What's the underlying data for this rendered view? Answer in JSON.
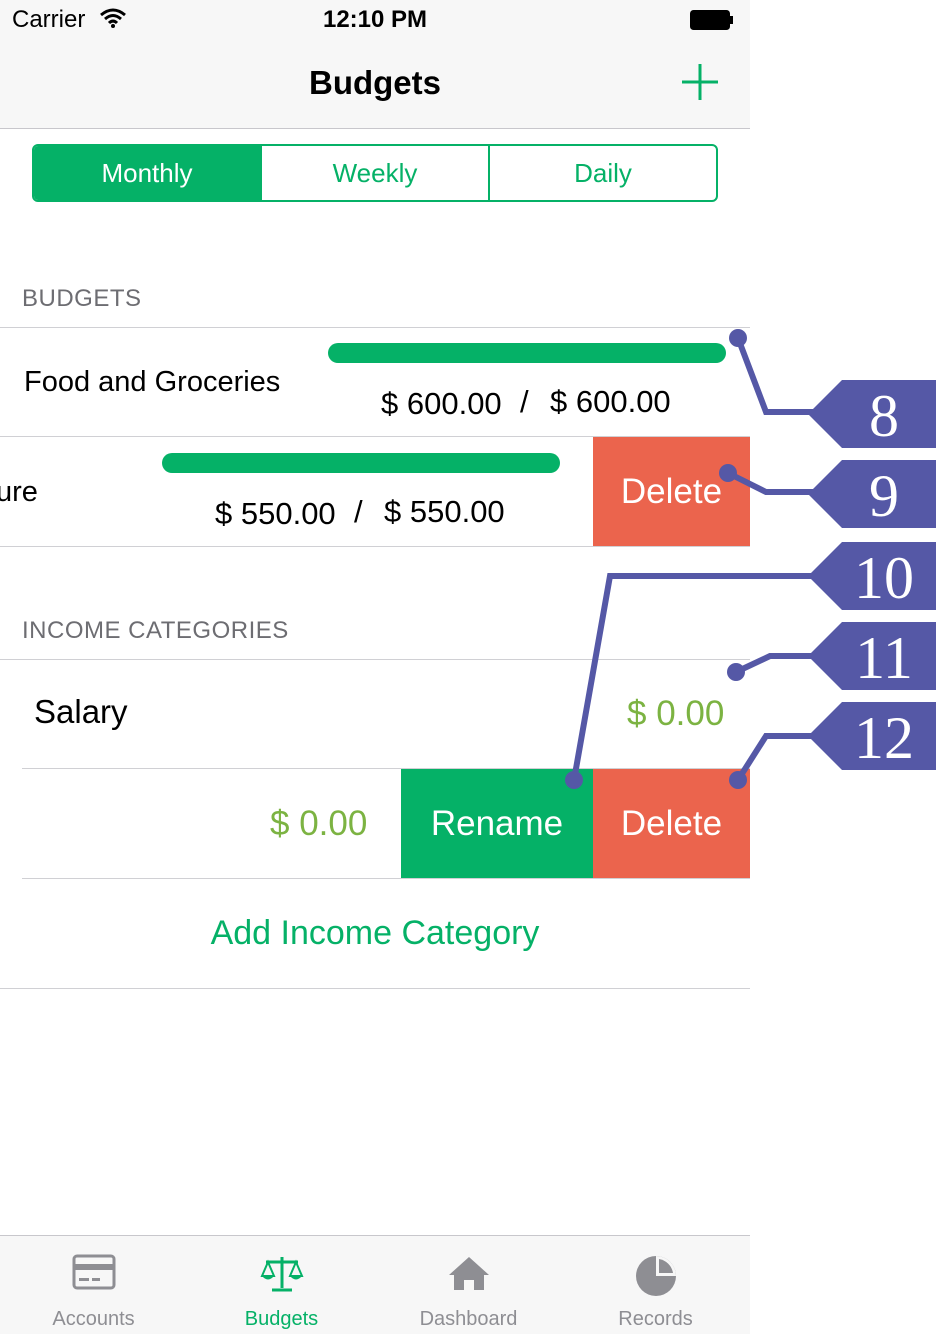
{
  "status_bar": {
    "carrier": "Carrier",
    "time": "12:10 PM"
  },
  "nav": {
    "title": "Budgets",
    "add_icon": "plus-icon"
  },
  "period_tabs": [
    {
      "label": "Monthly",
      "selected": true
    },
    {
      "label": "Weekly",
      "selected": false
    },
    {
      "label": "Daily",
      "selected": false
    }
  ],
  "budgets": {
    "header": "BUDGETS",
    "items": [
      {
        "label": "Food and Groceries",
        "spent": "$ 600.00",
        "separator": "/",
        "limit": "$ 600.00",
        "progress": 1.0
      },
      {
        "label_visible_fragment": "ure",
        "spent": "$ 550.00",
        "separator": "/",
        "limit": "$ 550.00",
        "progress": 1.0,
        "action": "Delete"
      }
    ]
  },
  "income": {
    "header": "INCOME CATEGORIES",
    "items": [
      {
        "label": "Salary",
        "amount": "$ 0.00"
      },
      {
        "amount": "$ 0.00",
        "actions": [
          "Rename",
          "Delete"
        ]
      }
    ],
    "add_label": "Add Income Category"
  },
  "tab_bar": [
    {
      "label": "Accounts",
      "icon": "credit-card-icon",
      "active": false
    },
    {
      "label": "Budgets",
      "icon": "scale-icon",
      "active": true
    },
    {
      "label": "Dashboard",
      "icon": "house-icon",
      "active": false
    },
    {
      "label": "Records",
      "icon": "pie-chart-icon",
      "active": false
    }
  ],
  "callouts": [
    "8",
    "9",
    "10",
    "11",
    "12"
  ],
  "colors": {
    "accent": "#05b167",
    "delete": "#eb644d",
    "income_amount": "#7cb342",
    "callout": "#5558a6"
  }
}
